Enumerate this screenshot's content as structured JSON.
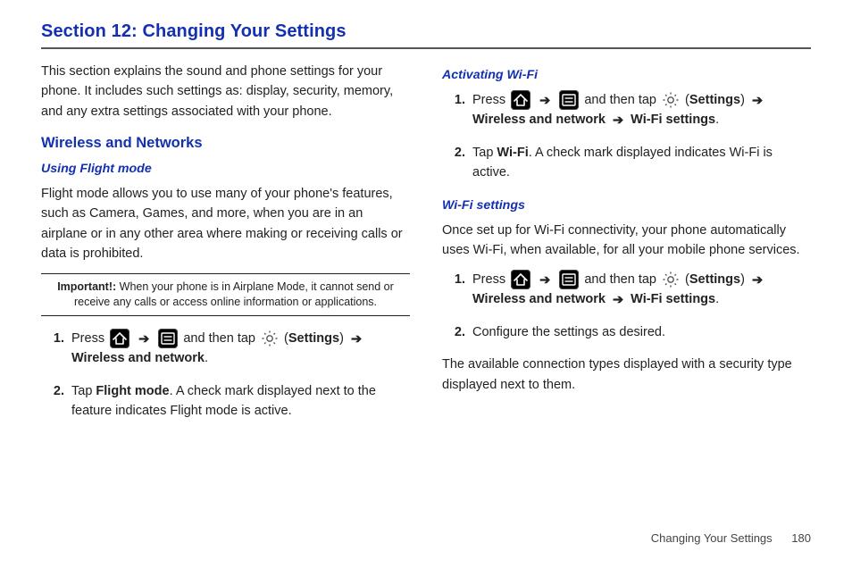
{
  "title": "Section 12: Changing Your Settings",
  "intro": "This section explains the sound and phone settings for your phone. It includes such settings as: display, security, memory, and any extra settings associated with your phone.",
  "wireless": {
    "heading": "Wireless and Networks",
    "flight": {
      "heading": "Using Flight mode",
      "desc": "Flight mode allows you to use many of your phone's features, such as Camera, Games, and more, when you are in an airplane or in any other area where making or receiving calls or data is prohibited.",
      "note_label": "Important!:",
      "note_text": "When your phone is in Airplane Mode, it cannot send or receive any calls or access online information or applications.",
      "steps": {
        "s1_press": "Press ",
        "s1_andtap": " and then tap ",
        "s1_settings": "Settings",
        "s1_wn": "Wireless and network",
        "s2_a": "Tap ",
        "s2_b": "Flight mode",
        "s2_c": ". A check mark displayed next to the feature indicates Flight mode is active."
      }
    },
    "wifi_activate": {
      "heading": "Activating Wi-Fi",
      "steps": {
        "s1_press": "Press ",
        "s1_andtap": " and then tap ",
        "s1_settings": "Settings",
        "s1_wn": "Wireless and network",
        "s1_ws": "Wi-Fi settings",
        "s2_a": "Tap ",
        "s2_b": "Wi-Fi",
        "s2_c": ". A check mark displayed indicates Wi-Fi is active."
      }
    },
    "wifi_settings": {
      "heading": "Wi-Fi settings",
      "desc": "Once set up for Wi-Fi connectivity, your phone automatically uses Wi-Fi, when available, for all your mobile phone services.",
      "steps": {
        "s1_press": "Press ",
        "s1_andtap": " and then tap ",
        "s1_settings": "Settings",
        "s1_wn": "Wireless and network",
        "s1_ws": "Wi-Fi settings",
        "s2": "Configure the settings as desired."
      },
      "tail": "The available connection types displayed with a security type displayed next to them."
    }
  },
  "footer": {
    "label": "Changing Your Settings",
    "page": "180"
  },
  "glyphs": {
    "arrow": "➔"
  }
}
